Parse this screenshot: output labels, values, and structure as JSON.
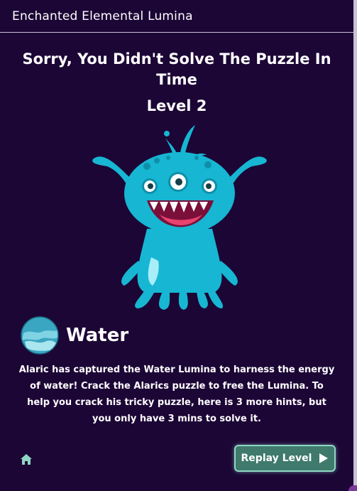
{
  "header": {
    "title": "Enchanted Elemental Lumina"
  },
  "result": {
    "title": "Sorry, You Didn't Solve The Puzzle In Time",
    "level": "Level 2"
  },
  "element": {
    "name": "Water",
    "icon": "water-orb-icon",
    "description": "Alaric has captured the Water Lumina to harness the energy of water! Crack the Alarics puzzle to free the Lumina. To help you crack his tricky puzzle, here is 3 more hints, but you only have 3 mins to solve it."
  },
  "controls": {
    "home_icon": "home-icon",
    "replay_label": "Replay Level",
    "replay_icon": "play-icon"
  },
  "colors": {
    "background": "#1c0636",
    "monster": "#17b6d3",
    "button": "#3f7a6c",
    "button_border": "#8fd6c4"
  }
}
